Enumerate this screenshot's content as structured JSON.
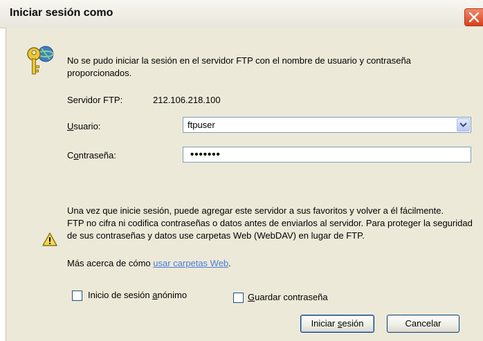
{
  "dialog": {
    "title": "Iniciar sesión como",
    "message": "No se pudo iniciar la sesión en el servidor FTP con el nombre de usuario y contraseña proporcionados.",
    "server_label": "Servidor FTP:",
    "server_value": "212.106.218.100",
    "user_label_access_key": "U",
    "user_label_rest": "suario:",
    "user_value": "ftpuser",
    "password_label_pre": "C",
    "password_label_access_key": "o",
    "password_label_rest": "ntraseña:",
    "password_value": "•••••••",
    "info_line1": "Una vez que inicie sesión, puede agregar este servidor a sus favoritos y volver a él fácilmente.",
    "info_line2": "FTP no cifra ni codifica contraseñas o datos antes de enviarlos al servidor.  Para proteger la seguridad de sus contraseñas y datos use carpetas Web (WebDAV) en lugar de FTP.",
    "more_prefix": "Más acerca de cómo ",
    "more_link": "usar carpetas Web",
    "more_suffix": ".",
    "anon_label_pre": "Inicio de sesión ",
    "anon_label_access_key": "a",
    "anon_label_rest": "nónimo",
    "anon_checked": false,
    "save_label_access_key": "G",
    "save_label_rest": "uardar contraseña",
    "save_checked": false,
    "login_button_pre": "Iniciar ",
    "login_button_access_key": "s",
    "login_button_rest": "esión",
    "cancel_button": "Cancelar"
  },
  "icons": {
    "close": "close-icon",
    "key": "key-icon",
    "warning": "warning-icon",
    "dropdown": "chevron-down-icon"
  },
  "colors": {
    "dialog_bg": "#ece9d8",
    "link": "#4a7bd8",
    "close_button": "#d7401c"
  }
}
